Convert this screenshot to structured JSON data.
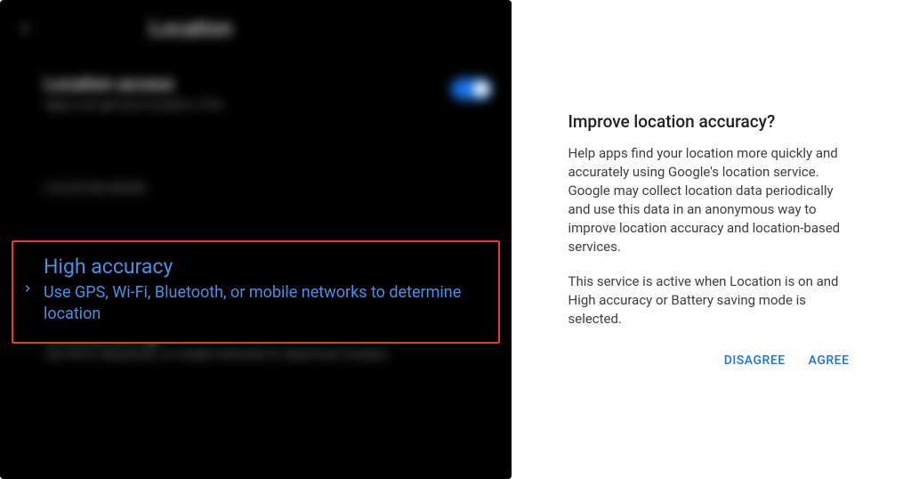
{
  "left": {
    "header_title": "Location",
    "location_access": {
      "title": "Location access",
      "subtitle": "Apps can get your location, 4 On"
    },
    "section_label": "LOCATION MODE",
    "high_accuracy": {
      "title": "High accuracy",
      "subtitle": "Use GPS, Wi-Fi, Bluetooth, or mobile networks to determine location"
    },
    "battery_saving": {
      "title": "Battery saving",
      "subtitle": "Use Wi-Fi, Bluetooth, or mobile networks to determine location"
    }
  },
  "dialog": {
    "title": "Improve location accuracy?",
    "body1": "Help apps find your location more quickly and accurately using Google's location service. Google may collect location data periodically and use this data in an anonymous way to improve location accuracy and location-based services.",
    "body2": "This service is active when Location is on and High accuracy or Battery saving mode is selected.",
    "disagree": "DISAGREE",
    "agree": "AGREE"
  }
}
